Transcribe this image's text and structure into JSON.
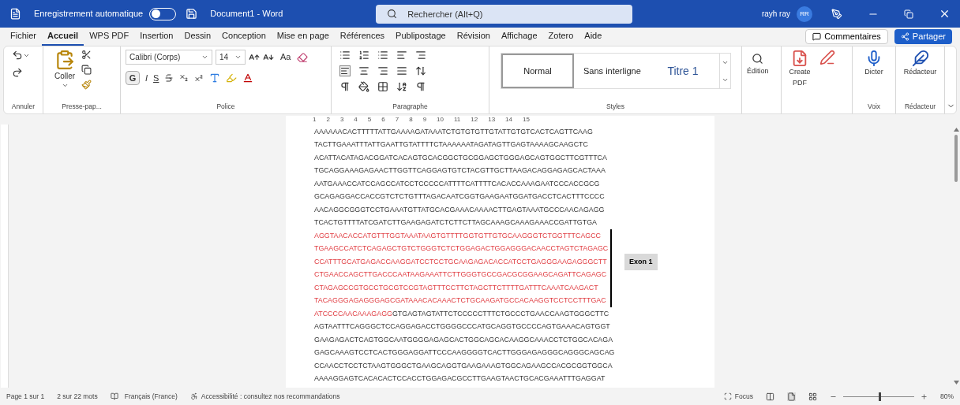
{
  "title_bar": {
    "autosave": {
      "label": "Enregistrement automatique",
      "on": false
    },
    "title": "Document1 - Word",
    "search": {
      "placeholder": "Rechercher (Alt+Q)"
    },
    "user": {
      "name": "rayh ray",
      "initials": "RR"
    }
  },
  "menu_tabs": [
    {
      "label": "Fichier",
      "selected": false
    },
    {
      "label": "Accueil",
      "selected": true
    },
    {
      "label": "WPS PDF",
      "selected": false
    },
    {
      "label": "Insertion",
      "selected": false
    },
    {
      "label": "Dessin",
      "selected": false
    },
    {
      "label": "Conception",
      "selected": false
    },
    {
      "label": "Mise en page",
      "selected": false
    },
    {
      "label": "Références",
      "selected": false
    },
    {
      "label": "Publipostage",
      "selected": false
    },
    {
      "label": "Révision",
      "selected": false
    },
    {
      "label": "Affichage",
      "selected": false
    },
    {
      "label": "Zotero",
      "selected": false
    },
    {
      "label": "Aide",
      "selected": false
    }
  ],
  "comments_button": "Commentaires",
  "share_button": "Partager",
  "ribbon": {
    "undo_label": "Annuler",
    "clipboard": {
      "paste": "Coller",
      "label": "Presse-pap..."
    },
    "font": {
      "name": "Calibri (Corps)",
      "size": "14",
      "case_button": "Aa",
      "bold": "G",
      "italic": "I",
      "underline": "S",
      "label": "Police"
    },
    "paragraph_label": "Paragraphe",
    "styles": {
      "label": "Styles",
      "items": [
        {
          "label": "Normal",
          "selected": true,
          "kind": "body"
        },
        {
          "label": "Sans interligne",
          "selected": false,
          "kind": "body"
        },
        {
          "label": "Titre 1",
          "selected": false,
          "kind": "heading"
        }
      ]
    },
    "edition": "Édition",
    "create_pdf": "Create PDF",
    "dictate": "Dicter",
    "voice_label": "Voix",
    "editor": "Rédacteur",
    "editor_label": "Rédacteur"
  },
  "ruler": {
    "marks": [
      "1",
      "2",
      "3",
      "4",
      "5",
      "6",
      "7",
      "8",
      "9",
      "10",
      "11",
      "12",
      "13",
      "14",
      "15"
    ]
  },
  "document": {
    "lines": [
      {
        "segments": [
          {
            "text": "AAAAAACACTTTTTATTGAAAAGATAAATCTGTGTGTTGTATTGTGTCACTCAGTTCAAG",
            "exon": false
          }
        ],
        "bracketed": false
      },
      {
        "segments": [
          {
            "text": "TACTTGAAATTTATTGAATTGTATTTTCTAAAAAATAGATAGTTGAGTAAAAGCAAGCTC",
            "exon": false
          }
        ],
        "bracketed": false
      },
      {
        "segments": [
          {
            "text": "ACATTACATAGACGGATCACAGTGCACGGCTGCGGAGCTGGGAGCAGTGGCTTCGTTTCA",
            "exon": false
          }
        ],
        "bracketed": false
      },
      {
        "segments": [
          {
            "text": "TGCAGGAAAGAGAACTTGGTTCAGGAGTGTCTACGTTGCTTAAGACAGGAGAGCACTAAA",
            "exon": false
          }
        ],
        "bracketed": false
      },
      {
        "segments": [
          {
            "text": "AATGAAACCATCCAGCCATCCTCCCCCATTTTCATTTTCACACCAAAGAATCCCACCGCG",
            "exon": false
          }
        ],
        "bracketed": false
      },
      {
        "segments": [
          {
            "text": "GCAGAGGACCACCGTCTCTGTTTAGACAATCGGTGAAGAATGGATGACCTCACTTTCCCC",
            "exon": false
          }
        ],
        "bracketed": false
      },
      {
        "segments": [
          {
            "text": "AACAGGCGGGTCCTGAAATGTTATGCACGAAACAAAACTTGAGTAAATGCCCAACAGAGG",
            "exon": false
          }
        ],
        "bracketed": false
      },
      {
        "segments": [
          {
            "text": "TCACTGTTTTATCGATCTTGAAGAGATCTCTTCTTAGCAAAGCAAAGAAACCGATTGTGA",
            "exon": false
          }
        ],
        "bracketed": false
      },
      {
        "segments": [
          {
            "text": "AGGTAACACCATGTTTGGTAAATAAGTGTTTTGGTGTTGTGCAAGGGTCTGGTTTCAGCC",
            "exon": true
          }
        ],
        "bracketed": true
      },
      {
        "segments": [
          {
            "text": "TGAAGCCATCTCAGAGCTGTCTGGGTCTCTGGAGACTGGAGGGACAACCTAGTCTAGAGC",
            "exon": true
          }
        ],
        "bracketed": true
      },
      {
        "segments": [
          {
            "text": "CCATTTGCATGAGACCAAGGATCCTCCTGCAAGAGACACCATCCTGAGGGAAGAGGGCTT",
            "exon": true
          }
        ],
        "bracketed": true,
        "annotation": "Exon 1"
      },
      {
        "segments": [
          {
            "text": "CTGAACCAGCTTGACCCAATAAGAAATTCTTGGGTGCCGACGCGGAAGCAGATTCAGAGC",
            "exon": true
          }
        ],
        "bracketed": true
      },
      {
        "segments": [
          {
            "text": "CTAGAGCCGTGCCTGCGTCCGTAGTTTCCTTCTAGCTTCTTTTGATTTCAAATCAAGACT",
            "exon": true
          }
        ],
        "bracketed": true
      },
      {
        "segments": [
          {
            "text": "TACAGGGAGAGGGAGCGATAAACACAAACTCTGCAAGATGCCACAAGGTCCTCCTTTGAC",
            "exon": true
          }
        ],
        "bracketed": true
      },
      {
        "segments": [
          {
            "text": "ATCCCCAACAAAGAGG",
            "exon": true
          },
          {
            "text": "GTGAGTAGTATTCTCCCCCTTTCTGCCCTGAACCAAGTGGGCTTC",
            "exon": false
          }
        ],
        "bracketed": false
      },
      {
        "segments": [
          {
            "text": "AGTAATTTCAGGGCTCCAGGAGACCTGGGGCCCATGCAGGTGCCCCAGTGAAACAGTGGT",
            "exon": false
          }
        ],
        "bracketed": false
      },
      {
        "segments": [
          {
            "text": "GAAGAGACTCAGTGGCAATGGGGAGAGCACTGGCAGCACAAGGCAAACCTCTGGCACAGA",
            "exon": false
          }
        ],
        "bracketed": false
      },
      {
        "segments": [
          {
            "text": "GAGCAAAGTCCTCACTGGGAGGATTCCCAAGGGGTCACTTGGGAGAGGGCAGGGCAGCAG",
            "exon": false
          }
        ],
        "bracketed": false
      },
      {
        "segments": [
          {
            "text": "CCAACCTCCTCTAAGTGGGCTGAAGCAGGTGAAGAAAGTGGCAGAAGCCACGCGGTGGCA",
            "exon": false
          }
        ],
        "bracketed": false
      },
      {
        "segments": [
          {
            "text": "AAAAGGAGTCACACACTCCACCTGGAGACGCCTTGAAGTAACTGCACGAAATTTGAGGAT",
            "exon": false
          }
        ],
        "bracketed": false
      }
    ]
  },
  "status_bar": {
    "page": "Page 1 sur 1",
    "words": "2 sur 22 mots",
    "language": "Français (France)",
    "accessibility": "Accessibilité : consultez nos recommandations",
    "focus": "Focus",
    "zoom": {
      "level": 0.5,
      "reading": "80%"
    }
  }
}
